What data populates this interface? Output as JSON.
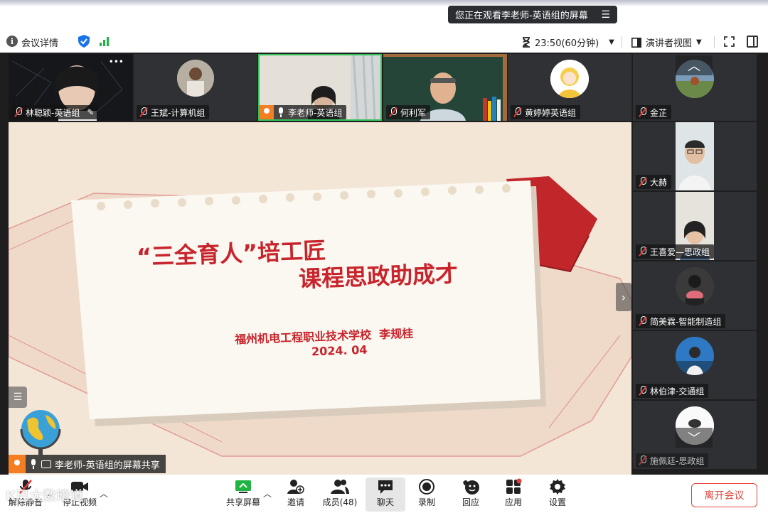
{
  "banner": {
    "text": "您正在观看李老师-英语组的屏幕"
  },
  "infobar": {
    "meeting_details": "会议详情",
    "timer": "23:50(60分钟)",
    "view_mode": "演讲者视图"
  },
  "top_participants": [
    {
      "name": "林聪颖-英语组",
      "mic": "off"
    },
    {
      "name": "王斌-计算机组",
      "mic": "off"
    },
    {
      "name": "李老师-英语组",
      "mic": "on",
      "host": true
    },
    {
      "name": "何利军",
      "mic": "off"
    },
    {
      "name": "黄婷婷英语组",
      "mic": "off"
    }
  ],
  "side_participants": [
    {
      "name": "金芷",
      "mic": "off"
    },
    {
      "name": "大赫",
      "mic": "off"
    },
    {
      "name": "王喜爱—思政组",
      "mic": "off"
    },
    {
      "name": "简美霖-智能制造组",
      "mic": "off"
    },
    {
      "name": "林伯津-交通组",
      "mic": "off"
    },
    {
      "name": "施佩廷-思政组",
      "mic": "off"
    }
  ],
  "slide": {
    "title_line1": "“三全育人”培工匠",
    "title_line2": "课程思政助成才",
    "school": "福州机电工程职业技术学校  李规桂",
    "date": "2024. 04"
  },
  "share_tag": {
    "text": "李老师-英语组的屏幕共享"
  },
  "toolbar": {
    "unmute": "解除静音",
    "stop_video": "停止视频",
    "share_screen": "共享屏幕",
    "invite": "邀请",
    "members": "成员(48)",
    "chat": "聊天",
    "record": "录制",
    "react": "回应",
    "apps": "应用",
    "settings": "设置",
    "leave": "离开会议"
  },
  "watermark": "K已大数暗道",
  "colors": {
    "accent_green": "#1fb341",
    "leave_red": "#e0453d",
    "host_orange": "#f57e22",
    "slide_red": "#c8242b"
  },
  "icons": [
    "info-icon",
    "shield-icon",
    "signal-icon",
    "hourglass-icon",
    "speaker-view-icon",
    "fullscreen-icon",
    "layout-icon",
    "mic-off-icon",
    "mic-on-icon",
    "video-icon",
    "share-screen-icon",
    "invite-icon",
    "members-icon",
    "chat-icon",
    "record-icon",
    "react-icon",
    "apps-icon",
    "settings-icon"
  ]
}
